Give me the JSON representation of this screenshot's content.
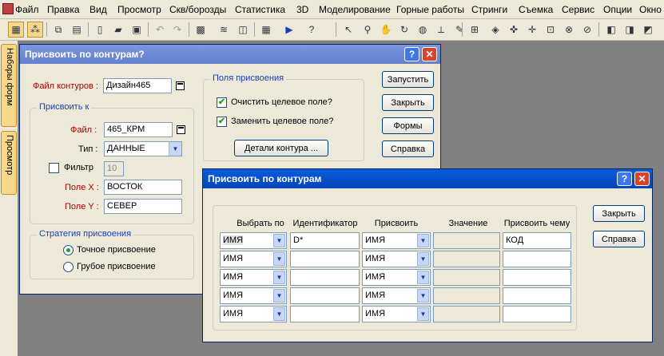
{
  "menu": [
    "Файл",
    "Правка",
    "Вид",
    "Просмотр",
    "Скв/борозды",
    "Статистика",
    "3D",
    "Моделирование",
    "Горные работы",
    "Стринги",
    "Съемка",
    "Сервис",
    "Опции",
    "Окно"
  ],
  "dock": {
    "tab1": "Наборы форм",
    "tab2": "Просмотр"
  },
  "dialog1": {
    "title": "Присвоить по контурам?",
    "contour_file_label": "Файл контуров :",
    "contour_file_value": "Дизайн465",
    "assign_to_group": "Присвоить к",
    "file_label": "Файл :",
    "file_value": "465_КРМ",
    "type_label": "Тип :",
    "type_value": "ДАННЫЕ",
    "filter_label": "Фильтр",
    "filter_value": "10",
    "field_x_label": "Поле X :",
    "field_x_value": "ВОСТОК",
    "field_y_label": "Поле Y :",
    "field_y_value": "СЕВЕР",
    "strategy_group": "Стратегия присвоения",
    "exact_label": "Точное присвоение",
    "rough_label": "Грубое присвоение",
    "fields_group": "Поля присвоения",
    "clear_label": "Очистить целевое поле?",
    "replace_label": "Заменить целевое поле?",
    "details_button": "Детали контура ...",
    "run_button": "Запустить",
    "close_button": "Закрыть",
    "forms_button": "Формы",
    "help_button": "Справка"
  },
  "dialog2": {
    "title": "Присвоить по контурам",
    "columns": [
      "Выбрать по",
      "Идентификатор",
      "Присвоить",
      "Значение",
      "Присвоить чему"
    ],
    "rows": [
      {
        "select_by": "ИМЯ",
        "identifier": "D*",
        "assign": "ИМЯ",
        "value": "",
        "assign_to": "КОД"
      },
      {
        "select_by": "ИМЯ",
        "identifier": "",
        "assign": "ИМЯ",
        "value": "",
        "assign_to": ""
      },
      {
        "select_by": "ИМЯ",
        "identifier": "",
        "assign": "ИМЯ",
        "value": "",
        "assign_to": ""
      },
      {
        "select_by": "ИМЯ",
        "identifier": "",
        "assign": "ИМЯ",
        "value": "",
        "assign_to": ""
      },
      {
        "select_by": "ИМЯ",
        "identifier": "",
        "assign": "ИМЯ",
        "value": "",
        "assign_to": ""
      }
    ],
    "close_button": "Закрыть",
    "help_button": "Справка"
  },
  "title_buttons": {
    "help": "?",
    "close": "✕"
  },
  "icons": [
    "app-icon",
    "layers-icon",
    "new-icon",
    "open-icon",
    "save-icon",
    "undo-icon",
    "redo-icon",
    "help-cursor-icon",
    "select-icon",
    "zoom-icon",
    "pan-icon"
  ]
}
